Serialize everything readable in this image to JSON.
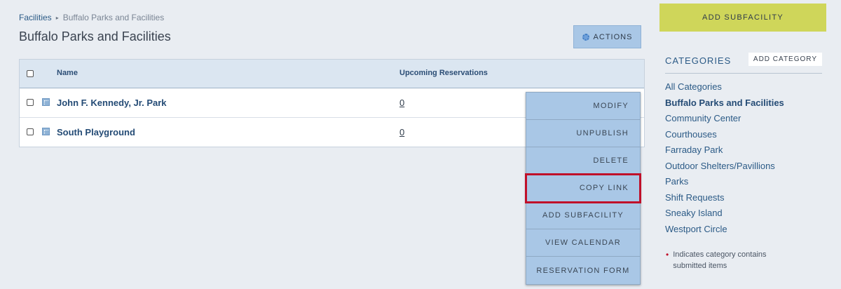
{
  "breadcrumb": {
    "root": "Facilities",
    "current": "Buffalo Parks and Facilities"
  },
  "page": {
    "title": "Buffalo Parks and Facilities",
    "actions_label": "ACTIONS"
  },
  "table": {
    "columns": {
      "name": "Name",
      "upcoming": "Upcoming Reservations"
    },
    "rows": [
      {
        "name": "John F. Kennedy, Jr. Park",
        "upcoming": "0"
      },
      {
        "name": "South Playground",
        "upcoming": "0"
      }
    ]
  },
  "actions_menu": {
    "items": [
      "MODIFY",
      "UNPUBLISH",
      "DELETE",
      "COPY LINK",
      "ADD SUBFACILITY",
      "VIEW CALENDAR",
      "RESERVATION FORM"
    ]
  },
  "sidebar": {
    "add_subfacility": "ADD SUBFACILITY",
    "categories_title": "CATEGORIES",
    "add_category": "ADD CATEGORY",
    "categories": [
      "All Categories",
      "Buffalo Parks and Facilities",
      "Community Center",
      "Courthouses",
      "Farraday Park",
      "Outdoor Shelters/Pavillions",
      "Parks",
      "Shift Requests",
      "Sneaky Island",
      "Westport Circle"
    ],
    "legend_text": "Indicates category contains submitted items"
  },
  "colors": {
    "accent_yellow": "#cfd65a",
    "menu_blue": "#a9c7e6",
    "highlight_red": "#c0102a"
  },
  "icons": {
    "actions": "gear-icon",
    "facility": "building-icon",
    "legend": "bullet-icon"
  }
}
